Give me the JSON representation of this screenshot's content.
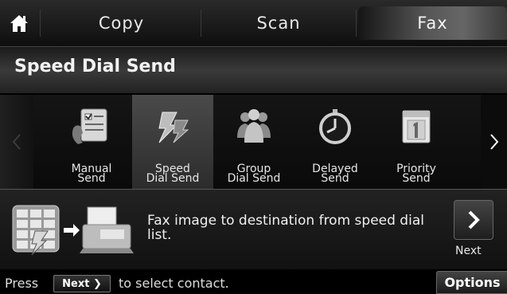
{
  "tabs": [
    {
      "label": "Copy"
    },
    {
      "label": "Scan"
    },
    {
      "label": "Fax",
      "selected": true
    }
  ],
  "header": {
    "title": "Speed Dial Send"
  },
  "menu": {
    "items": [
      {
        "label_line1": "Manual",
        "label_line2": "Send",
        "icon": "manual-send-icon"
      },
      {
        "label_line1": "Speed",
        "label_line2": "Dial Send",
        "icon": "speed-dial-icon",
        "selected": true
      },
      {
        "label_line1": "Group",
        "label_line2": "Dial Send",
        "icon": "group-dial-icon"
      },
      {
        "label_line1": "Delayed",
        "label_line2": "Send",
        "icon": "clock-icon"
      },
      {
        "label_line1": "Priority",
        "label_line2": "Send",
        "icon": "calendar-icon"
      }
    ]
  },
  "description": {
    "text": "Fax image to destination from speed dial list."
  },
  "next": {
    "label": "Next"
  },
  "footer": {
    "press": "Press",
    "key": "Next",
    "after": "to select contact.",
    "options": "Options"
  },
  "colors": {
    "background": "#000000",
    "selected_tab": "#5a5a5a",
    "text": "#f0f0f0"
  }
}
